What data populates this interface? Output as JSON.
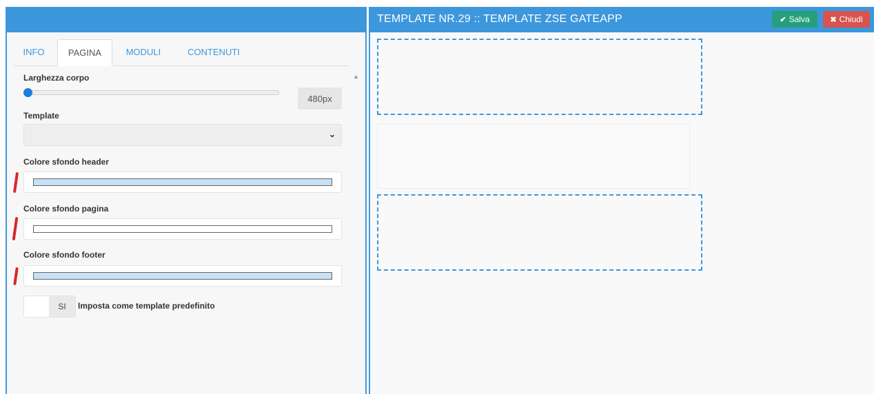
{
  "left_panel": {
    "tabs": [
      {
        "label": "INFO"
      },
      {
        "label": "PAGINA"
      },
      {
        "label": "MODULI"
      },
      {
        "label": "CONTENUTI"
      }
    ],
    "active_tab": "PAGINA",
    "width_field": {
      "label": "Larghezza corpo",
      "value": "480px",
      "slider_fraction": 0.0
    },
    "template_field": {
      "label": "Template",
      "value": ""
    },
    "header_color": {
      "label": "Colore sfondo header",
      "color": "#c6e0f5"
    },
    "page_color": {
      "label": "Colore sfondo pagina",
      "color": "#ffffff"
    },
    "footer_color": {
      "label": "Colore sfondo footer",
      "color": "#c6e0f5"
    },
    "default_toggle": {
      "state": "SI",
      "label": "Imposta come template predefinito"
    }
  },
  "right_panel": {
    "title": "TEMPLATE NR.29 :: TEMPLATE ZSE GATEAPP",
    "save_label": "Salva",
    "close_label": "Chiudi"
  },
  "colors": {
    "accent": "#3d97dc",
    "save": "#26a07a",
    "close": "#d9534f",
    "annotation": "#d7262a"
  },
  "icons": {
    "save": "check-icon",
    "close": "x-icon",
    "select": "chevron-down-icon",
    "scroll": "caret-up-icon"
  }
}
